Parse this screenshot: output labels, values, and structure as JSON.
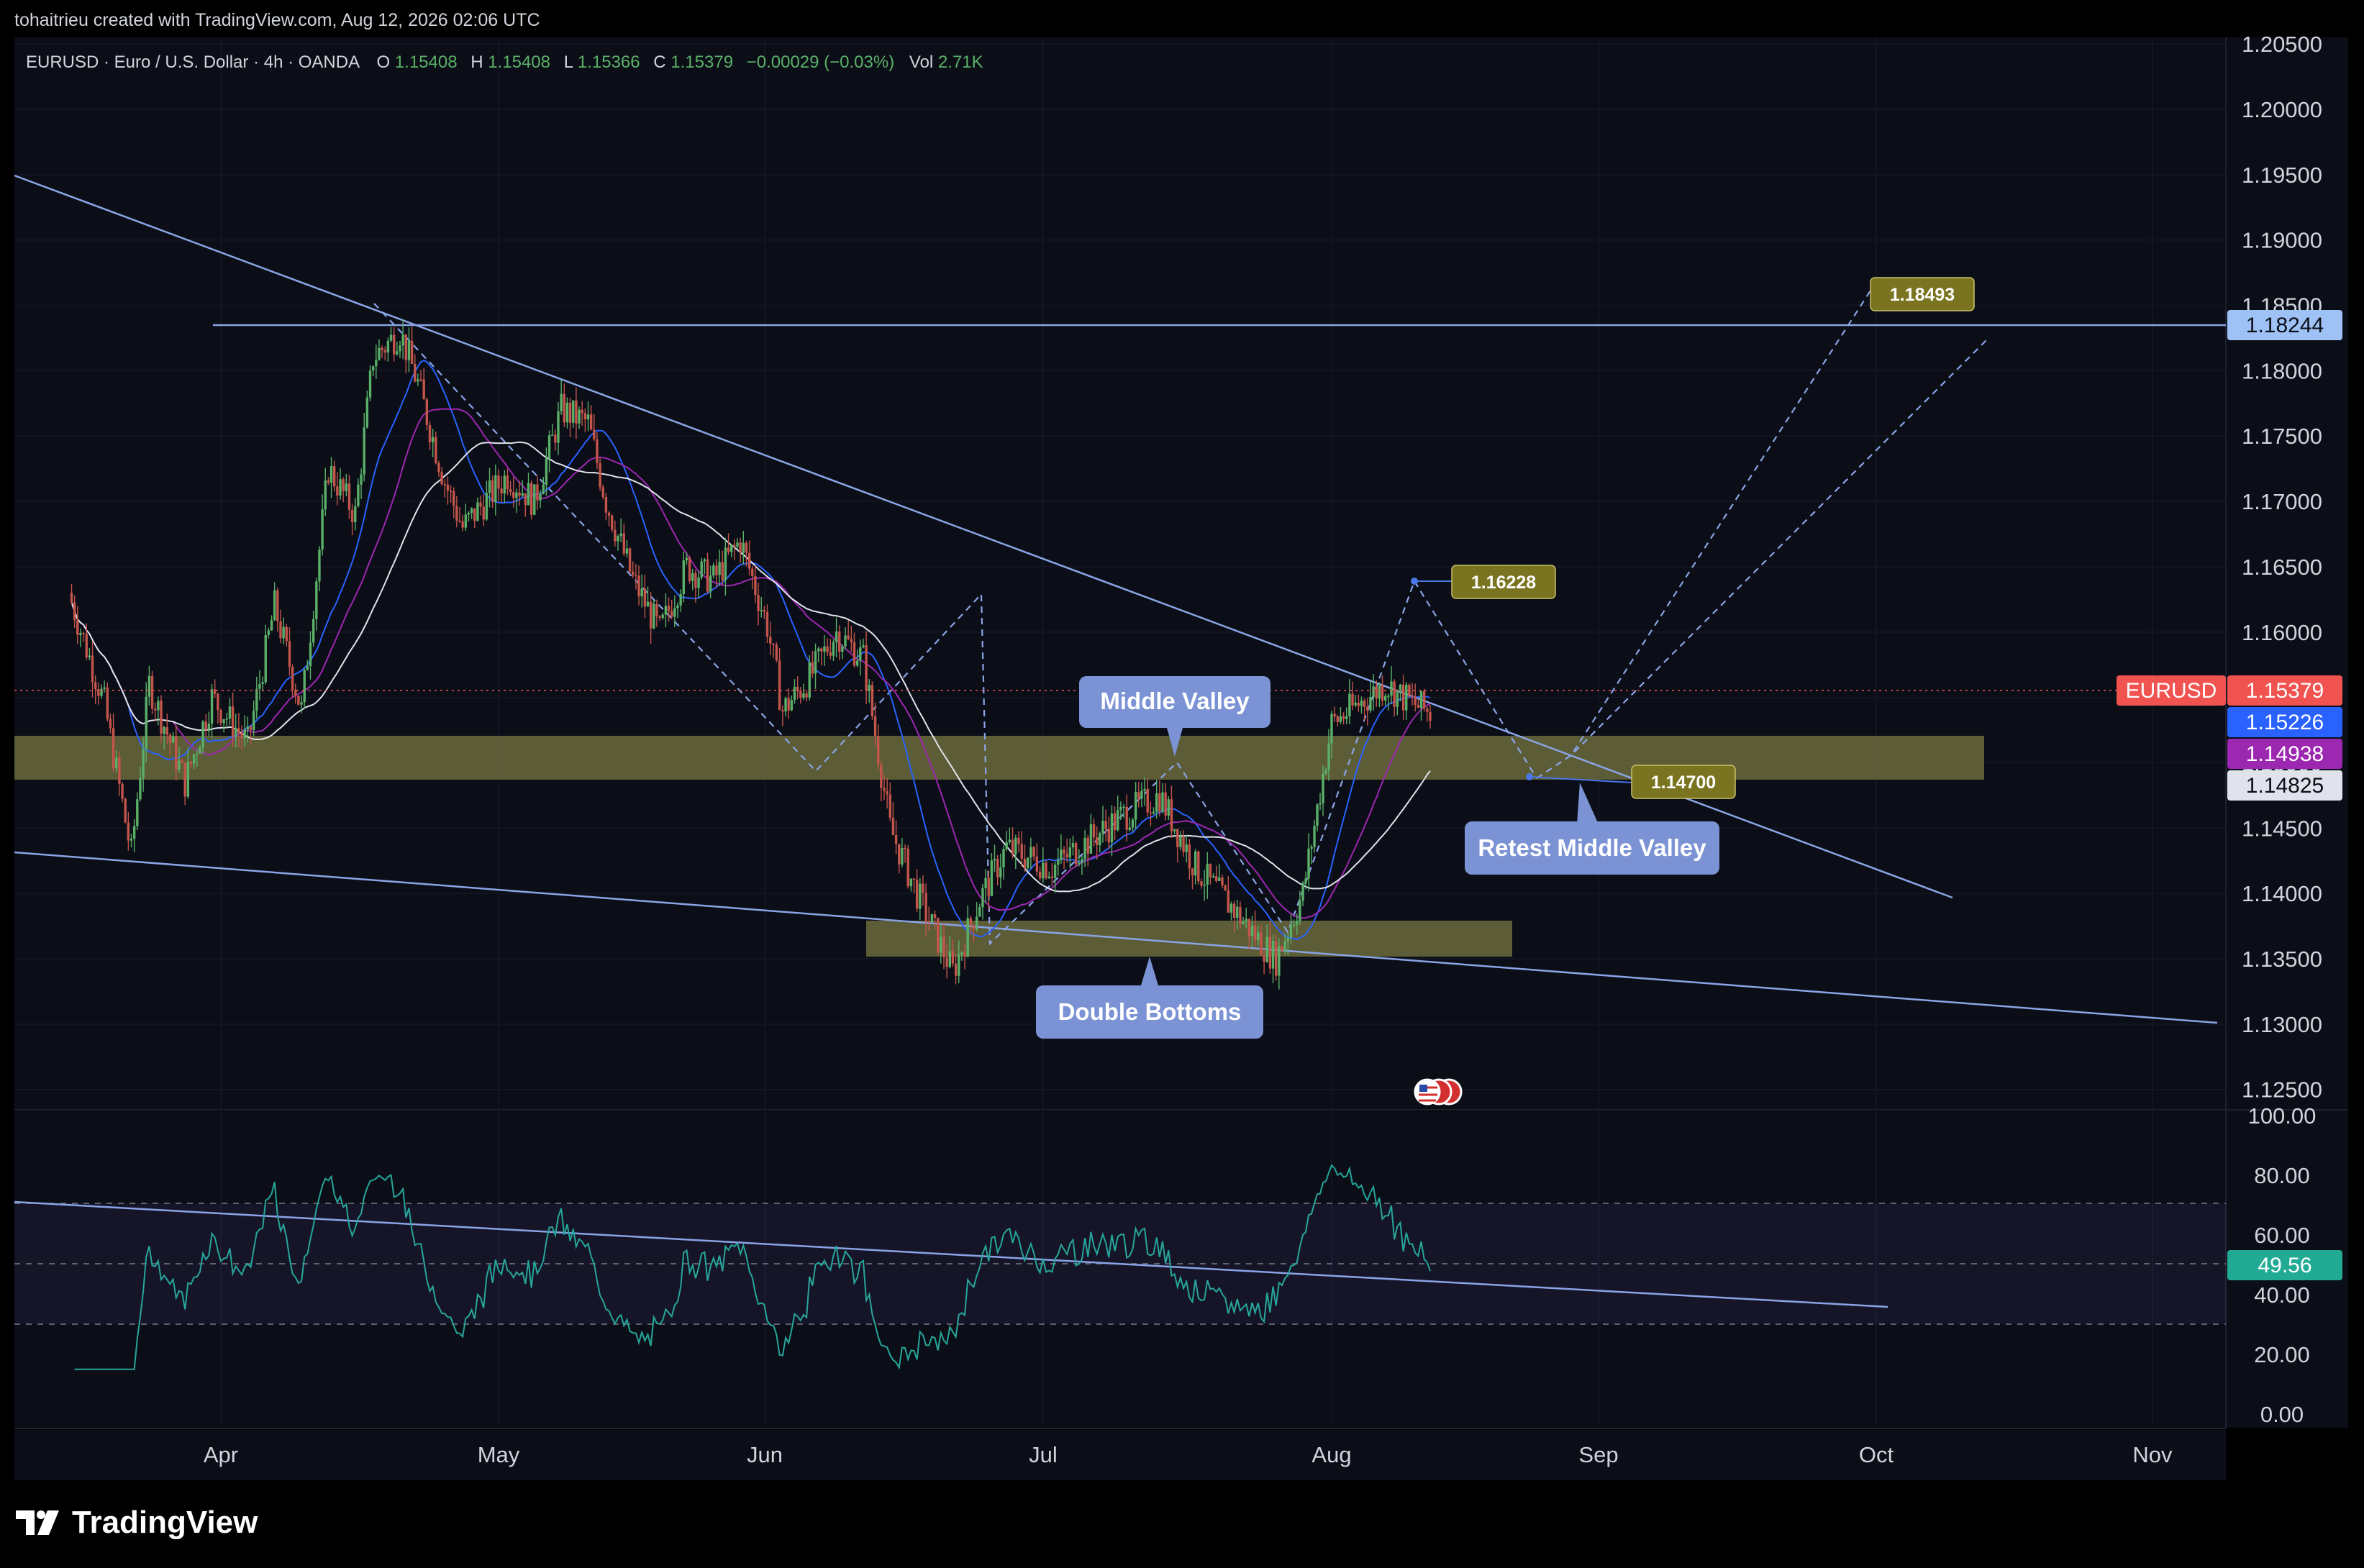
{
  "header": {
    "credit": "tohaitrieu created with TradingView.com, Aug 12, 2026 02:06 UTC"
  },
  "legend": {
    "symbol_text": "EURUSD · Euro / U.S. Dollar · 4h · OANDA",
    "o_label": "O",
    "o_value": "1.15408",
    "h_label": "H",
    "h_value": "1.15408",
    "l_label": "L",
    "l_value": "1.15366",
    "c_label": "C",
    "c_value": "1.15379",
    "change": "−0.00029 (−0.03%)",
    "vol_label": "Vol",
    "vol_value": "2.71K"
  },
  "annotations": {
    "middle_valley": "Middle Valley",
    "double_bottoms": "Double Bottoms",
    "retest": "Retest Middle Valley",
    "target1": "1.16228",
    "target2": "1.18493",
    "retest_level": "1.14700"
  },
  "price_labels": {
    "symbol": "EURUSD",
    "last": "1.15379",
    "ma_blue": "1.15226",
    "ma_purple": "1.14938",
    "ma_white": "1.14825",
    "hline": "1.18244",
    "rsi_value": "49.56"
  },
  "footer": {
    "brand": "TradingView"
  },
  "colors": {
    "background": "#0b0e17",
    "grid": "#141824",
    "up_candle": "#5bb068",
    "down_candle": "#c4554b",
    "ma_blue": "#2962ff",
    "ma_purple": "#9c27b0",
    "ma_white": "#e0e3eb",
    "trendline": "#8aa4e6",
    "zone": "#6b6a3c",
    "callout": "#7b93d4",
    "target_label": "#7a7420",
    "price_red": "#f05350",
    "rsi_line": "#26a69a",
    "rsi_value_bg": "#22ab94"
  },
  "chart_data": [
    {
      "type": "candlestick",
      "title": "EURUSD · Euro / U.S. Dollar · 4h · OANDA",
      "x_ticks": [
        "Apr",
        "May",
        "Jun",
        "Jul",
        "Aug",
        "Sep",
        "Oct",
        "Nov"
      ],
      "y_ticks": [
        "1.20500",
        "1.20000",
        "1.19500",
        "1.19000",
        "1.18500",
        "1.18000",
        "1.17500",
        "1.17000",
        "1.16500",
        "1.16000",
        "1.15500",
        "1.15000",
        "1.14500",
        "1.14000",
        "1.13500",
        "1.13000",
        "1.12500"
      ],
      "ylim": [
        1.1235,
        1.2055
      ],
      "close_path": [
        {
          "date": "Mar 15",
          "close": 1.163
        },
        {
          "date": "Mar 19",
          "close": 1.1545
        },
        {
          "date": "Mar 22",
          "close": 1.143
        },
        {
          "date": "Mar 24",
          "close": 1.156
        },
        {
          "date": "Mar 28",
          "close": 1.1485
        },
        {
          "date": "Mar 31",
          "close": 1.155
        },
        {
          "date": "Apr 4",
          "close": 1.1515
        },
        {
          "date": "Apr 7",
          "close": 1.162
        },
        {
          "date": "Apr 10",
          "close": 1.154
        },
        {
          "date": "Apr 13",
          "close": 1.1725
        },
        {
          "date": "Apr 16",
          "close": 1.169
        },
        {
          "date": "Apr 18",
          "close": 1.181
        },
        {
          "date": "Apr 21",
          "close": 1.183
        },
        {
          "date": "Apr 23",
          "close": 1.179
        },
        {
          "date": "Apr 26",
          "close": 1.1715
        },
        {
          "date": "Apr 28",
          "close": 1.168
        },
        {
          "date": "May 2",
          "close": 1.172
        },
        {
          "date": "May 5",
          "close": 1.17
        },
        {
          "date": "May 8",
          "close": 1.177
        },
        {
          "date": "May 11",
          "close": 1.176
        },
        {
          "date": "May 13",
          "close": 1.17
        },
        {
          "date": "May 16",
          "close": 1.164
        },
        {
          "date": "May 19",
          "close": 1.16
        },
        {
          "date": "May 22",
          "close": 1.165
        },
        {
          "date": "May 25",
          "close": 1.164
        },
        {
          "date": "May 28",
          "close": 1.167
        },
        {
          "date": "May 31",
          "close": 1.1605
        },
        {
          "date": "Jun 3",
          "close": 1.154
        },
        {
          "date": "Jun 6",
          "close": 1.1565
        },
        {
          "date": "Jun 9",
          "close": 1.16
        },
        {
          "date": "Jun 12",
          "close": 1.158
        },
        {
          "date": "Jun 15",
          "close": 1.145
        },
        {
          "date": "Jun 18",
          "close": 1.14
        },
        {
          "date": "Jun 22",
          "close": 1.134
        },
        {
          "date": "Jun 25",
          "close": 1.1395
        },
        {
          "date": "Jun 28",
          "close": 1.1435
        },
        {
          "date": "Jul 2",
          "close": 1.142
        },
        {
          "date": "Jul 6",
          "close": 1.144
        },
        {
          "date": "Jul 10",
          "close": 1.146
        },
        {
          "date": "Jul 14",
          "close": 1.1475
        },
        {
          "date": "Jul 18",
          "close": 1.142
        },
        {
          "date": "Jul 22",
          "close": 1.139
        },
        {
          "date": "Jul 25",
          "close": 1.1365
        },
        {
          "date": "Jul 27",
          "close": 1.135
        },
        {
          "date": "Jul 30",
          "close": 1.14
        },
        {
          "date": "Aug 1",
          "close": 1.153
        },
        {
          "date": "Aug 4",
          "close": 1.1545
        },
        {
          "date": "Aug 7",
          "close": 1.156
        },
        {
          "date": "Aug 9",
          "close": 1.155
        },
        {
          "date": "Aug 12",
          "close": 1.15379
        }
      ],
      "moving_averages": [
        {
          "name": "MA blue",
          "last": 1.15226
        },
        {
          "name": "MA purple",
          "last": 1.14938
        },
        {
          "name": "MA white",
          "last": 1.14825
        }
      ],
      "horizontal_line": 1.18244,
      "zones": [
        {
          "label": "Middle Valley",
          "from": 1.1468,
          "to": 1.1502
        },
        {
          "label": "Double Bottoms",
          "from": 1.133,
          "to": 1.1357
        }
      ],
      "projection_targets": [
        1.16228,
        1.147,
        1.18493
      ]
    },
    {
      "type": "line",
      "title": "RSI",
      "y_ticks": [
        "100.00",
        "80.00",
        "60.00",
        "40.00",
        "20.00",
        "0.00"
      ],
      "ylim": [
        0,
        100
      ],
      "bands": [
        30,
        50,
        70
      ],
      "last": 49.56
    }
  ]
}
